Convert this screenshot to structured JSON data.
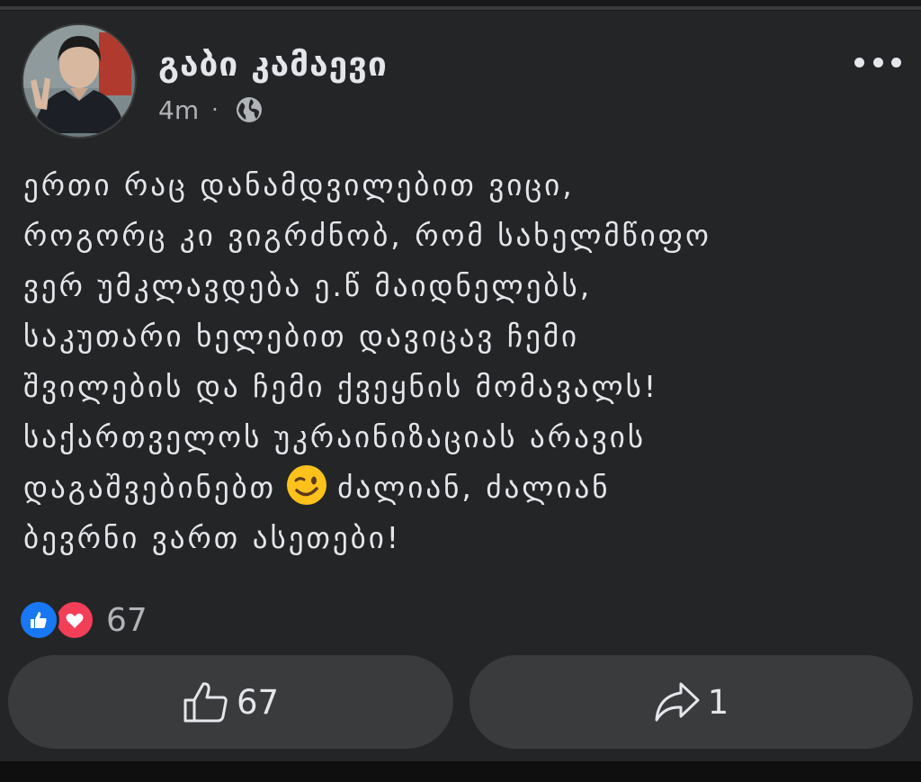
{
  "post": {
    "author": "გაბი კამაევი",
    "time": "4m",
    "separator": "·",
    "privacy_icon": "globe-icon",
    "options_icon": "more-horizontal-icon",
    "text_lines": [
      "ერთი რაც დანამდვილებით ვიცი,",
      "როგორც კი ვიგრძნობ, რომ სახელმწიფო",
      "ვერ უმკლავდება ე.წ მაიდნელებს,",
      "საკუთარი ხელებით დავიცავ ჩემი",
      "შვილების და ჩემი ქვეყნის მომავალს!",
      "საქართველოს უკრაინიზაციას არავის",
      "დაგაშვებინებთ",
      "ძალიან, ძალიან",
      "ბევრნი ვართ ასეთები!"
    ],
    "emoji": "winking-face-emoji"
  },
  "reactions": {
    "types": [
      "like",
      "love"
    ],
    "count": "67"
  },
  "actions": {
    "like_count": "67",
    "share_count": "1"
  },
  "colors": {
    "background": "#242526",
    "text": "#e4e6eb",
    "secondary_text": "#b0b3b8",
    "button_bg": "#3a3b3c",
    "like_blue": "#1877f2",
    "love_red": "#f33e58"
  }
}
